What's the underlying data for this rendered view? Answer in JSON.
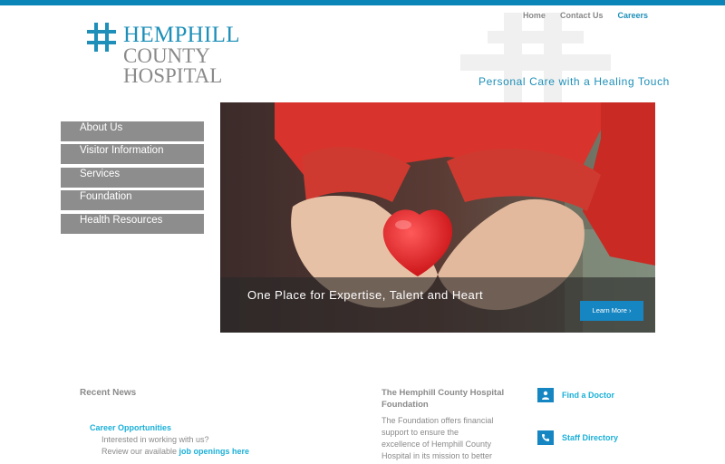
{
  "header": {
    "logo": {
      "line1": "HEMPHILL",
      "line2": "COUNTY",
      "line3": "HOSPITAL"
    },
    "tagline": "Personal Care with a Healing Touch",
    "topnav": [
      {
        "label": "Home"
      },
      {
        "label": "Contact Us"
      },
      {
        "label": "Careers"
      }
    ]
  },
  "sidebar": {
    "items": [
      {
        "label": "About Us"
      },
      {
        "label": "Visitor Information"
      },
      {
        "label": "Services"
      },
      {
        "label": "Foundation"
      },
      {
        "label": "Health Resources"
      }
    ]
  },
  "hero": {
    "caption": "One Place for Expertise, Talent and Heart",
    "button_label": "Learn More ›"
  },
  "news": {
    "title": "Recent News",
    "item_title": "Career Opportunities",
    "line1": "Interested in working with us?",
    "line2_prefix": "Review our available ",
    "line2_link": "job openings here"
  },
  "foundation": {
    "title": "The Hemphill County Hospital Foundation",
    "text": "The Foundation offers financial support to ensure the excellence of Hemphill County Hospital in its mission to better"
  },
  "quicklinks": [
    {
      "label": "Find a Doctor",
      "icon": "person-icon"
    },
    {
      "label": "Staff Directory",
      "icon": "phone-icon"
    }
  ],
  "colors": {
    "accent": "#1d8fb8",
    "link": "#1ab0d8",
    "nav_bg": "#8d8d8d",
    "button": "#1686c2"
  }
}
